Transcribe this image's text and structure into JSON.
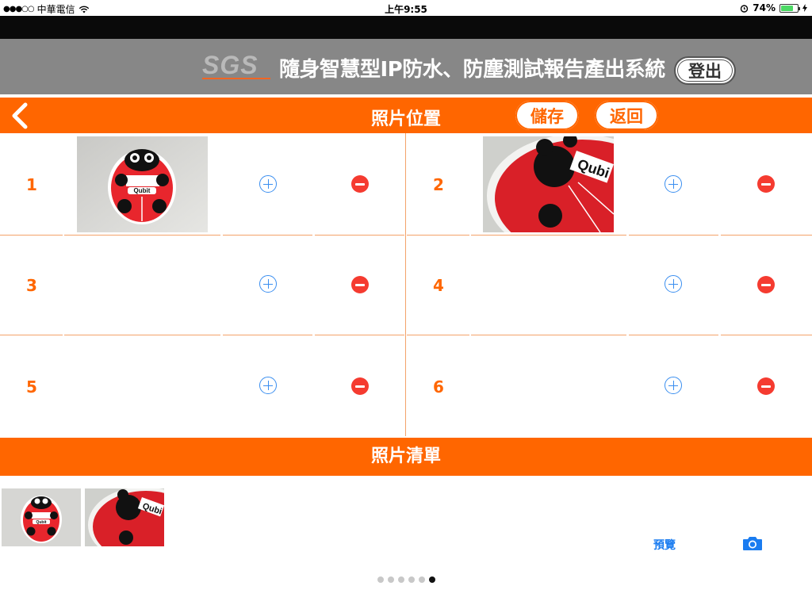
{
  "status": {
    "carrier": "中華電信",
    "signal_dots": "●●●○○",
    "time": "上午9:55",
    "battery": "74%",
    "battery_level": 0.74
  },
  "header": {
    "logo_text": "SGS",
    "title": "隨身智慧型IP防水、防塵測試報告產出系統",
    "logout_label": "登出"
  },
  "navbar": {
    "title": "照片位置",
    "save_label": "儲存",
    "back_label": "返回"
  },
  "slots": [
    {
      "number": "1",
      "has_photo": true
    },
    {
      "number": "2",
      "has_photo": true
    },
    {
      "number": "3",
      "has_photo": false
    },
    {
      "number": "4",
      "has_photo": false
    },
    {
      "number": "5",
      "has_photo": false
    },
    {
      "number": "6",
      "has_photo": false
    }
  ],
  "photo_list": {
    "title": "照片清單",
    "preview_label": "預覽"
  },
  "pager": {
    "count": 6,
    "active": 5
  },
  "colors": {
    "accent": "#ff6600",
    "header_gray": "#878787",
    "link_blue": "#1a7cf0",
    "delete_red": "#f53b30"
  }
}
